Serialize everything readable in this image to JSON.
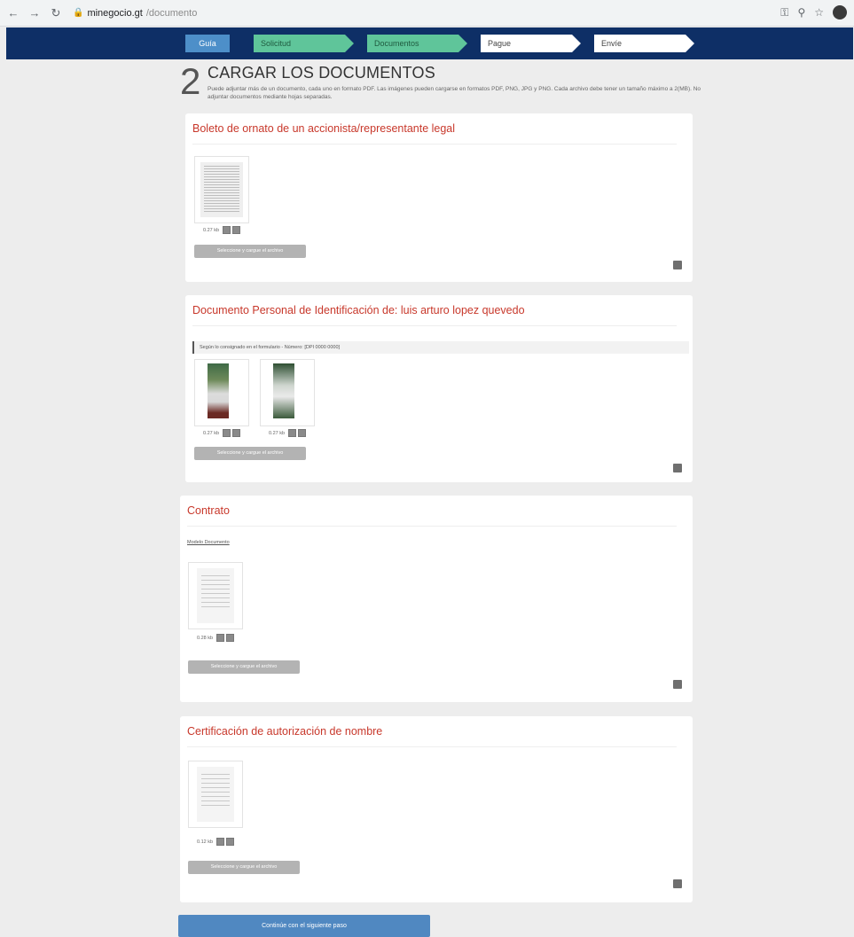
{
  "browser": {
    "url_host": "minegocio.gt",
    "url_path": "/documento",
    "back_icon": "arrow-left-icon",
    "forward_icon": "arrow-right-icon",
    "reload_icon": "reload-icon"
  },
  "steps": {
    "ayuda": "Guía",
    "solicitud": "Solicitud",
    "documentos": "Documentos",
    "pague": "Pague",
    "envie": "Envíe"
  },
  "header": {
    "number": "2",
    "title": "CARGAR LOS DOCUMENTOS",
    "instructions": "Puede adjuntar más de un documento, cada uno en formato PDF. Las imágenes pueden cargarse en formatos PDF, PNG, JPG y PNG. Cada archivo debe tener un tamaño máximo a 2(MB). No adjuntar documentos mediante hojas separadas."
  },
  "cards": [
    {
      "title": "Boleto de ornato de un accionista/representante legal",
      "files": [
        {
          "size": "0.27 kb"
        }
      ],
      "upload_label": "Seleccione y cargue el archivo"
    },
    {
      "title": "Documento Personal de Identificación de: luis arturo lopez quevedo",
      "notice": "Según lo consignado en el formulario - Número: [DPI 0000 0000]",
      "files": [
        {
          "size": "0.27 kb"
        },
        {
          "size": "0.27 kb"
        }
      ],
      "upload_label": "Seleccione y cargue el archivo"
    },
    {
      "title": "Contrato",
      "link": "Modelo Documento",
      "files": [
        {
          "size": "0.28 kb"
        }
      ],
      "upload_label": "Seleccione y cargue el archivo"
    },
    {
      "title": "Certificación de autorización de nombre",
      "files": [
        {
          "size": "0.12 kb"
        }
      ],
      "upload_label": "Seleccione y cargue el archivo"
    }
  ],
  "continue_label": "Continúe con el siguiente paso"
}
